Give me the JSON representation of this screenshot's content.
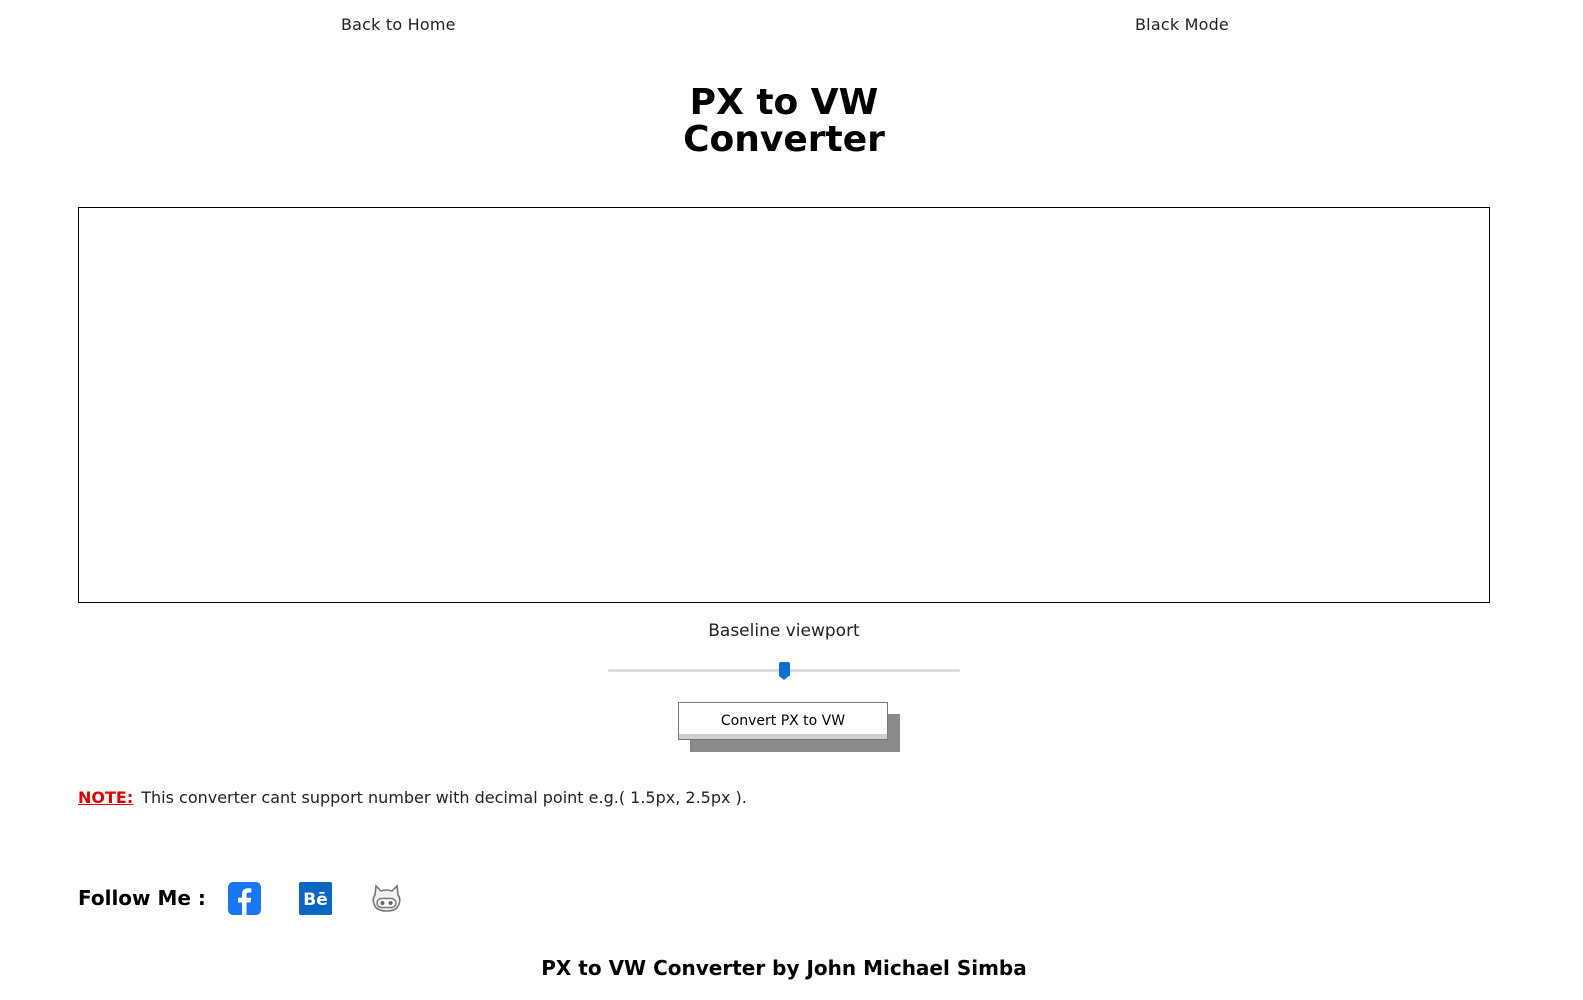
{
  "nav": {
    "home_label": "Back to Home",
    "mode_label": "Black Mode"
  },
  "header": {
    "title_line1": "PX to VW",
    "title_line2": "Converter"
  },
  "converter": {
    "input_value": "",
    "viewport_label": "Baseline viewport",
    "slider_value_fraction": 0.5,
    "convert_label": "Convert PX to VW"
  },
  "note": {
    "label": "NOTE:",
    "text": "This converter cant support number with decimal point e.g.( 1.5px, 2.5px )."
  },
  "social": {
    "follow_label": "Follow Me :",
    "links": [
      {
        "icon": "facebook-icon",
        "color": "#1877f2"
      },
      {
        "icon": "behance-icon",
        "color": "#0a66c2"
      },
      {
        "icon": "github-icon",
        "color": "#555555"
      }
    ]
  },
  "footer": {
    "credit": "PX to VW Converter by John Michael Simba"
  },
  "colors": {
    "accent": "#0a6fd1",
    "note": "#e00000"
  }
}
